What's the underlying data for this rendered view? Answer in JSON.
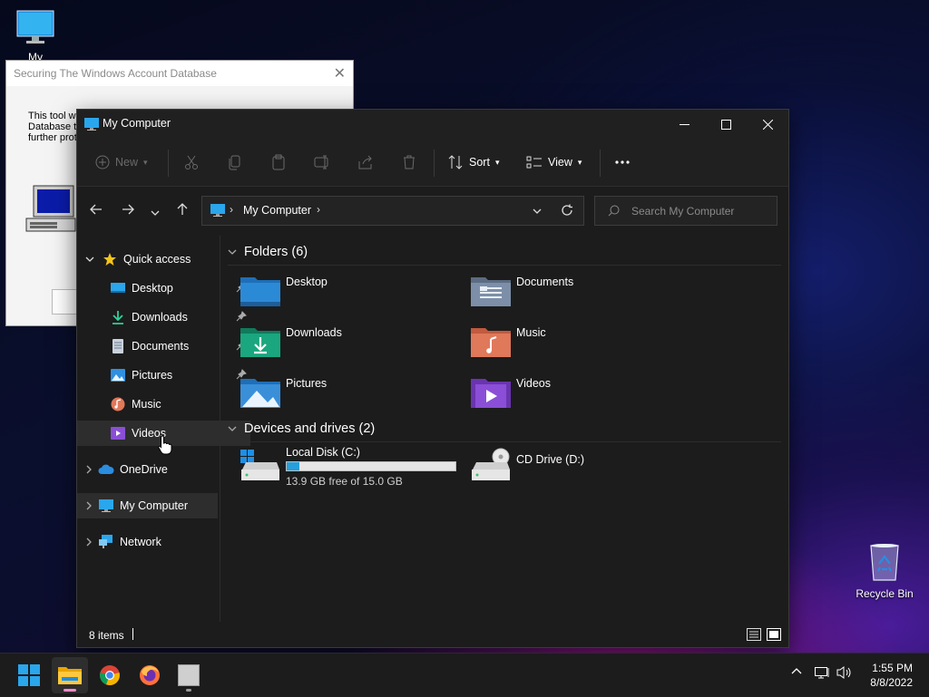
{
  "desktop": {
    "my_computer_label": "My Computer",
    "recycle_bin_label": "Recycle Bin"
  },
  "old_dialog": {
    "title": "Securing The Windows Account Database",
    "body_lines": [
      "This tool wi",
      "Database t",
      "further prote"
    ]
  },
  "explorer": {
    "title": "My Computer",
    "toolbar": {
      "new_label": "New",
      "sort_label": "Sort",
      "view_label": "View"
    },
    "address": {
      "crumb": "My Computer",
      "search_placeholder": "Search My Computer"
    },
    "sidebar": {
      "quick_access": "Quick access",
      "items": [
        {
          "label": "Desktop",
          "icon": "desktop-icon",
          "pinned": true
        },
        {
          "label": "Downloads",
          "icon": "downloads-icon",
          "pinned": true
        },
        {
          "label": "Documents",
          "icon": "documents-icon",
          "pinned": true
        },
        {
          "label": "Pictures",
          "icon": "pictures-icon",
          "pinned": true
        },
        {
          "label": "Music",
          "icon": "music-icon",
          "pinned": false
        },
        {
          "label": "Videos",
          "icon": "videos-icon",
          "pinned": false
        }
      ],
      "onedrive": "OneDrive",
      "my_computer": "My Computer",
      "network": "Network"
    },
    "folders_header": "Folders (6)",
    "folders": [
      {
        "label": "Desktop",
        "color": "#2b8ad6"
      },
      {
        "label": "Documents",
        "color": "#7d8fa8"
      },
      {
        "label": "Downloads",
        "color": "#1aa67e"
      },
      {
        "label": "Music",
        "color": "#e0785a"
      },
      {
        "label": "Pictures",
        "color": "#3a8fd9"
      },
      {
        "label": "Videos",
        "color": "#8a4fd6"
      }
    ],
    "devices_header": "Devices and drives (2)",
    "drives": [
      {
        "label": "Local Disk (C:)",
        "free_text": "13.9 GB free of 15.0 GB",
        "used_fraction": 0.073
      },
      {
        "label": "CD Drive (D:)"
      }
    ],
    "status": {
      "items_count": "8 items"
    }
  },
  "taskbar": {
    "time": "1:55 PM",
    "date": "8/8/2022"
  },
  "colors": {
    "accent": "#0078d4",
    "window_bg": "#1c1c1c",
    "titlebar_bg": "#202020"
  }
}
